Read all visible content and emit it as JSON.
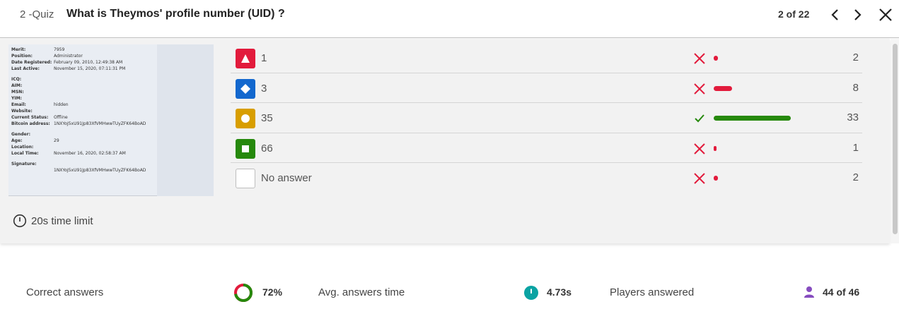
{
  "header": {
    "quiz_label": "2 -Quiz",
    "question": "What is Theymos' profile number (UID) ?",
    "page_count": "2 of 22"
  },
  "profile_image": {
    "lines": [
      {
        "key": "Merit:",
        "value": "7959"
      },
      {
        "key": "Position:",
        "value": "Administrator"
      },
      {
        "key": "Date Registered:",
        "value": "February 09, 2010, 12:49:38 AM"
      },
      {
        "key": "Last Active:",
        "value": "November 15, 2020, 07:11:31 PM"
      },
      {
        "key": "ICQ:",
        "value": ""
      },
      {
        "key": "AIM:",
        "value": ""
      },
      {
        "key": "MSN:",
        "value": ""
      },
      {
        "key": "YIM:",
        "value": ""
      },
      {
        "key": "Email:",
        "value": "hidden"
      },
      {
        "key": "Website:",
        "value": ""
      },
      {
        "key": "Current Status:",
        "value": "Offline"
      },
      {
        "key": "Bitcoin address:",
        "value": "1NXYoJ5xU91Jp83XfVMHwwTUyZFK64BoAD"
      },
      {
        "key": "Gender:",
        "value": ""
      },
      {
        "key": "Age:",
        "value": "29"
      },
      {
        "key": "Location:",
        "value": ""
      },
      {
        "key": "Local Time:",
        "value": "November 16, 2020, 02:58:37 AM"
      },
      {
        "key": "Signature:",
        "value": ""
      },
      {
        "key": "",
        "value": "1NXYoJ5xU91Jp83XfVMHwwTUyZFK64BoAD"
      }
    ]
  },
  "time_limit": "20s time limit",
  "answers": [
    {
      "text": "1",
      "shape": "triangle",
      "color": "#e21b3c",
      "correct": false,
      "count": "2",
      "fraction": 0.04
    },
    {
      "text": "3",
      "shape": "diamond",
      "color": "#1368ce",
      "correct": false,
      "count": "8",
      "fraction": 0.17
    },
    {
      "text": "35",
      "shape": "circle",
      "color": "#d89e00",
      "correct": true,
      "count": "33",
      "fraction": 0.72
    },
    {
      "text": "66",
      "shape": "square",
      "color": "#26890c",
      "correct": false,
      "count": "1",
      "fraction": 0.02
    },
    {
      "text": "No answer",
      "shape": "none",
      "color": "#ffffff",
      "correct": false,
      "count": "2",
      "fraction": 0.04
    }
  ],
  "colors": {
    "correct_bar": "#26890c",
    "wrong_bar": "#e21b3c",
    "wrong_mark": "#e21b3c",
    "correct_mark": "#26890c"
  },
  "stats": {
    "correct_label": "Correct answers",
    "correct_value": "72%",
    "correct_fraction": 0.72,
    "avg_label": "Avg. answers time",
    "avg_value": "4.73s",
    "players_label": "Players answered",
    "players_value": "44 of 46"
  }
}
